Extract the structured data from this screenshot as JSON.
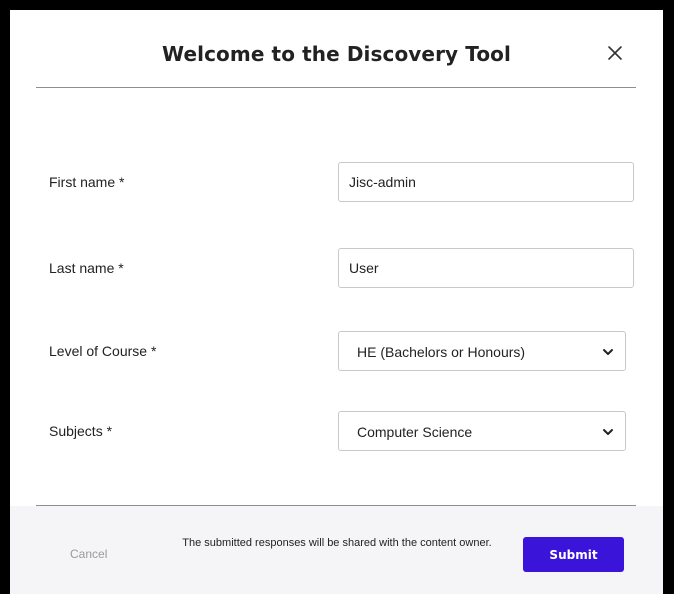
{
  "dialog": {
    "title": "Welcome to the Discovery Tool",
    "close_icon": "close-icon"
  },
  "form": {
    "first_name": {
      "label": "First name *",
      "value": "Jisc-admin"
    },
    "last_name": {
      "label": "Last name *",
      "value": "User"
    },
    "level_of_course": {
      "label": "Level of Course *",
      "selected": "HE (Bachelors or Honours)",
      "icon": "chevron-down-icon"
    },
    "subjects": {
      "label": "Subjects *",
      "selected": "Computer Science",
      "icon": "chevron-down-icon"
    }
  },
  "footer": {
    "cancel_label": "Cancel",
    "note": "The submitted responses will be shared with the content owner.",
    "submit_label": "Submit"
  },
  "colors": {
    "accent": "#3b14d9",
    "footer_bg": "#f5f5f7",
    "divider": "#8f8f8f"
  }
}
